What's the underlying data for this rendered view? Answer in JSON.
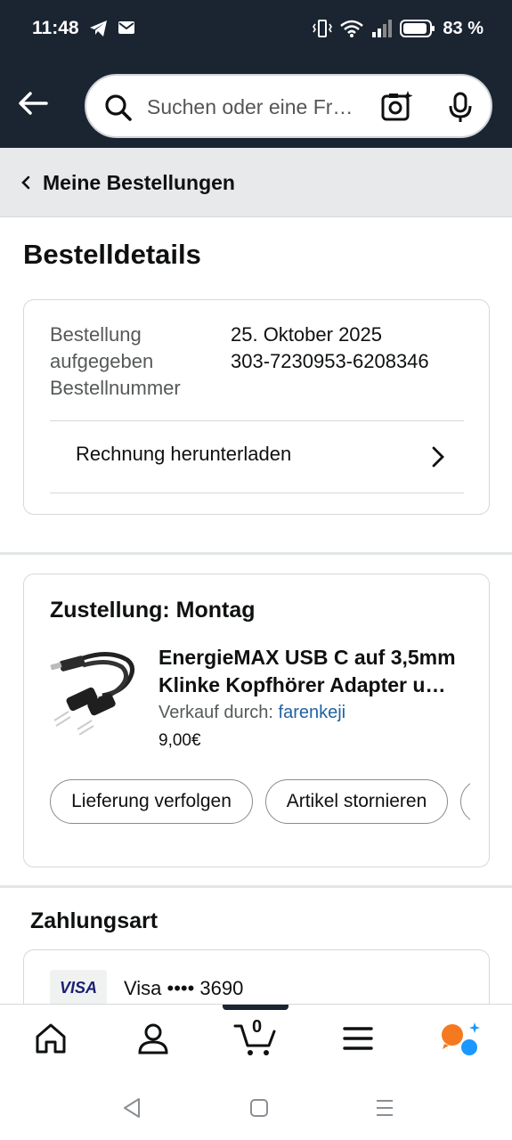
{
  "status_bar": {
    "time": "11:48",
    "battery_percent": "83 %"
  },
  "search": {
    "placeholder": "Suchen oder eine Fr…"
  },
  "breadcrumb": {
    "label": "Meine Bestellungen"
  },
  "page": {
    "title": "Bestelldetails"
  },
  "order_info": {
    "placed_label": "Bestellung aufgegeben",
    "placed_value": "25. Oktober 2025",
    "number_label": "Bestellnummer",
    "number_value": "303-7230953-6208346",
    "invoice_label": "Rechnung herunterladen"
  },
  "delivery": {
    "title": "Zustellung: Montag",
    "product_title": "EnergieMAX USB C auf 3,5mm Klinke Kopfhörer Adapter u…",
    "seller_prefix": "Verkauf durch:",
    "seller_name": "farenkeji",
    "price": "9,00€",
    "track_button": "Lieferung verfolgen",
    "cancel_button": "Artikel stornieren"
  },
  "payment": {
    "title": "Zahlungsart",
    "card_brand": "VISA",
    "card_text": "Visa •••• 3690"
  },
  "bottom_nav": {
    "cart_count": "0"
  },
  "colors": {
    "header_bg": "#1b2431",
    "link": "#2162a1",
    "alexa_orange": "#f4791f",
    "alexa_blue": "#1a98ff"
  }
}
